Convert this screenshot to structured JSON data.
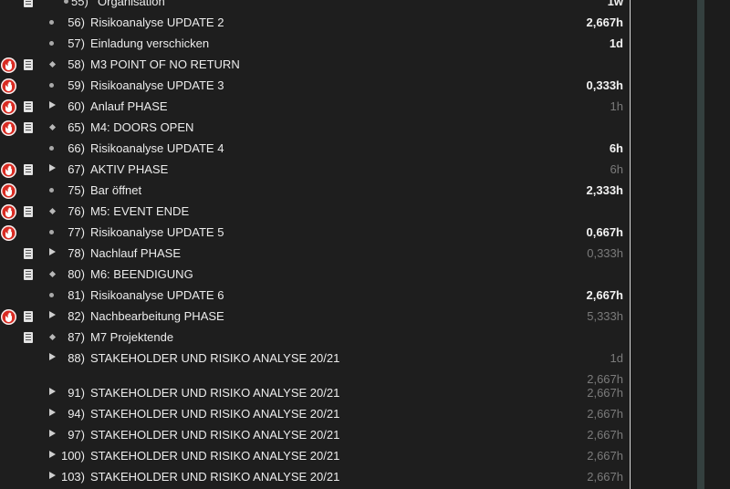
{
  "rows": [
    {
      "num": "55)",
      "label": "Organisation",
      "dur": "1w",
      "style": "bold",
      "stop": false,
      "note": true,
      "marker": "dot"
    },
    {
      "num": "56)",
      "label": "Risikoanalyse UPDATE 2",
      "dur": "2,667h",
      "style": "bold",
      "stop": false,
      "note": false,
      "marker": "dot"
    },
    {
      "num": "57)",
      "label": "Einladung verschicken",
      "dur": "1d",
      "style": "bold",
      "stop": false,
      "note": false,
      "marker": "dot"
    },
    {
      "num": "58)",
      "label": "M3 POINT OF NO RETURN",
      "dur": "",
      "style": "bold",
      "stop": true,
      "note": true,
      "marker": "diamond"
    },
    {
      "num": "59)",
      "label": "Risikoanalyse UPDATE 3",
      "dur": "0,333h",
      "style": "bold",
      "stop": true,
      "note": false,
      "marker": "dot"
    },
    {
      "num": "60)",
      "label": "Anlauf PHASE",
      "dur": "1h",
      "style": "dim",
      "stop": true,
      "note": true,
      "marker": "triangle"
    },
    {
      "num": "65)",
      "label": "M4: DOORS OPEN",
      "dur": "",
      "style": "bold",
      "stop": true,
      "note": true,
      "marker": "diamond"
    },
    {
      "num": "66)",
      "label": "Risikoanalyse UPDATE 4",
      "dur": "6h",
      "style": "bold",
      "stop": false,
      "note": false,
      "marker": "dot"
    },
    {
      "num": "67)",
      "label": "AKTIV PHASE",
      "dur": "6h",
      "style": "dim",
      "stop": true,
      "note": true,
      "marker": "triangle"
    },
    {
      "num": "75)",
      "label": "Bar öffnet",
      "dur": "2,333h",
      "style": "bold",
      "stop": true,
      "note": false,
      "marker": "dot"
    },
    {
      "num": "76)",
      "label": "M5: EVENT ENDE",
      "dur": "",
      "style": "bold",
      "stop": true,
      "note": true,
      "marker": "diamond"
    },
    {
      "num": "77)",
      "label": "Risikoanalyse UPDATE 5",
      "dur": "0,667h",
      "style": "bold",
      "stop": true,
      "note": false,
      "marker": "dot"
    },
    {
      "num": "78)",
      "label": "Nachlauf PHASE",
      "dur": "0,333h",
      "style": "dim",
      "stop": false,
      "note": true,
      "marker": "triangle"
    },
    {
      "num": "80)",
      "label": "M6: BEENDIGUNG",
      "dur": "",
      "style": "bold",
      "stop": false,
      "note": true,
      "marker": "diamond"
    },
    {
      "num": "81)",
      "label": "Risikoanalyse UPDATE 6",
      "dur": "2,667h",
      "style": "bold",
      "stop": false,
      "note": false,
      "marker": "dot"
    },
    {
      "num": "82)",
      "label": "Nachbearbeitung PHASE",
      "dur": "5,333h",
      "style": "dim",
      "stop": true,
      "note": true,
      "marker": "triangle"
    },
    {
      "num": "87)",
      "label": "M7 Projektende",
      "dur": "",
      "style": "bold",
      "stop": false,
      "note": true,
      "marker": "diamond"
    },
    {
      "num": "88)",
      "label": "STAKEHOLDER UND RISIKO ANALYSE 20/21",
      "dur": "1d",
      "sub": "2,667h",
      "style": "dim",
      "stop": false,
      "note": false,
      "marker": "triangle"
    },
    {
      "num": "91)",
      "label": "STAKEHOLDER UND RISIKO ANALYSE 20/21",
      "dur": "2,667h",
      "style": "dim",
      "stop": false,
      "note": false,
      "marker": "triangle"
    },
    {
      "num": "94)",
      "label": "STAKEHOLDER UND RISIKO ANALYSE 20/21",
      "dur": "2,667h",
      "style": "dim",
      "stop": false,
      "note": false,
      "marker": "triangle"
    },
    {
      "num": "97)",
      "label": "STAKEHOLDER UND RISIKO ANALYSE 20/21",
      "dur": "2,667h",
      "style": "dim",
      "stop": false,
      "note": false,
      "marker": "triangle"
    },
    {
      "num": "100)",
      "label": "STAKEHOLDER UND RISIKO ANALYSE 20/21",
      "dur": "2,667h",
      "style": "dim",
      "stop": false,
      "note": false,
      "marker": "triangle"
    },
    {
      "num": "103)",
      "label": "STAKEHOLDER UND RISIKO ANALYSE 20/21",
      "dur": "2,667h",
      "style": "dim",
      "stop": false,
      "note": false,
      "marker": "triangle"
    }
  ],
  "icons": {
    "stop": "stop-hand-icon",
    "note": "note-icon",
    "triangle": "disclosure-triangle-icon",
    "dot": "task-bullet-icon",
    "diamond": "milestone-diamond-icon"
  },
  "colors": {
    "stop": "#d92b22",
    "background": "#1e1e1e",
    "dim_text": "#7b7b7b",
    "scroll_track": "#34403f"
  }
}
